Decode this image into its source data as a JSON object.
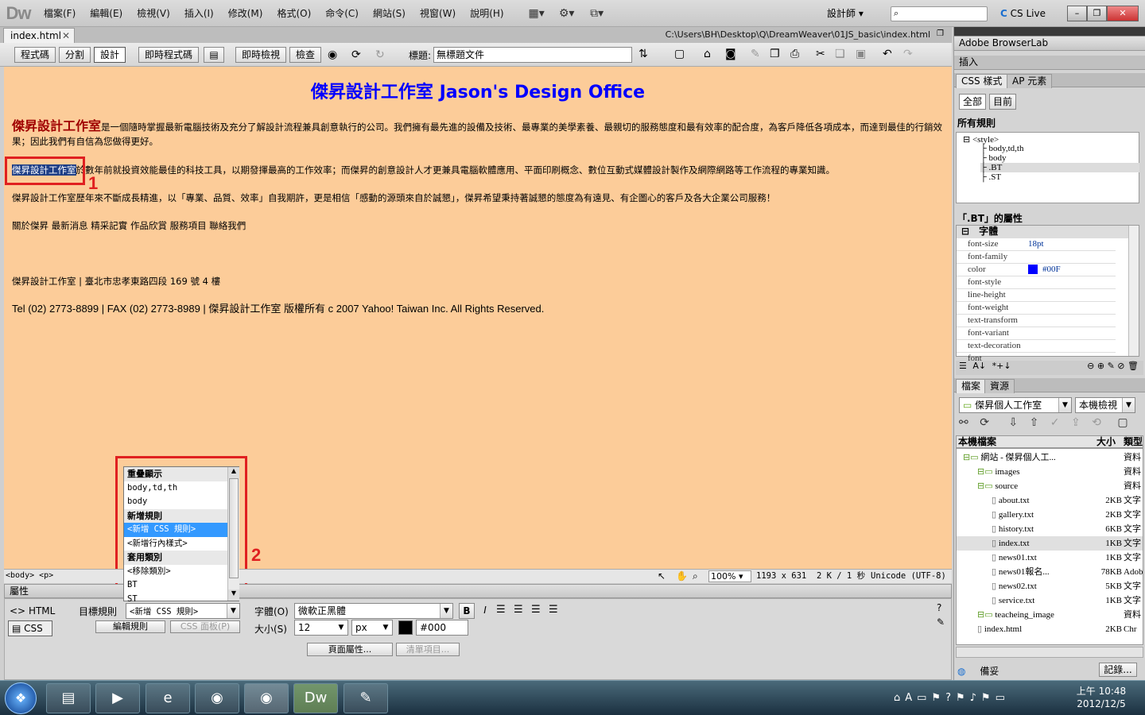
{
  "app": {
    "logo": "Dw"
  },
  "menus": [
    "檔案(F)",
    "編輯(E)",
    "檢視(V)",
    "插入(I)",
    "修改(M)",
    "格式(O)",
    "命令(C)",
    "網站(S)",
    "視窗(W)",
    "說明(H)"
  ],
  "workspace": "設計師",
  "cslive": "CS Live",
  "document": {
    "tab": "index.html",
    "path": "C:\\Users\\BH\\Desktop\\Q\\DreamWeaver\\01JS_basic\\index.html"
  },
  "toolbar": {
    "code": "程式碼",
    "split": "分割",
    "design": "設計",
    "livecode": "即時程式碼",
    "liveview": "即時檢視",
    "inspect": "檢查",
    "title_label": "標題:",
    "title_value": "無標題文件"
  },
  "page": {
    "heading": "傑昇設計工作室 Jason's Design Office",
    "p1_bt": "傑昇設計工作室",
    "p1_text": "是一個隨時掌握最新電腦技術及充分了解設計流程兼具創意執行的公司。我們擁有最先進的設備及技術、最專業的美學素養、最親切的服務態度和最有效率的配合度，為客戶降低各項成本，而達到最佳的行銷效果；因此我們有自信為您做得更好。",
    "p2_sel": "傑昇設計工作室",
    "p2_text": "於數年前就投資效能最佳的科技工具，以期發揮最高的工作效率；而傑昇的創意設計人才更兼具電腦軟體應用、平面印刷概念、數位互動式媒體設計製作及網際網路等工作流程的專業知識。",
    "p3": "傑昇設計工作室歷年來不斷成長精進，以「專業、品質、效率」自我期許，更是相信「感動的源頭來自於誠懇」，傑昇希望秉持著誠懇的態度為有遠見、有企圖心的客戶及各大企業公司服務！",
    "nav": "關於傑昇 最新消息 精采記實 作品欣賞 服務項目 聯絡我們",
    "address": "傑昇設計工作室 | 臺北市忠孝東路四段 169 號 4 樓",
    "footer": "Tel (02) 2773-8899 | FAX (02) 2773-8989 | 傑昇設計工作室 版權所有 c 2007 Yahoo! Taiwan Inc. All Rights Reserved."
  },
  "annotations": {
    "one": "1",
    "two": "2"
  },
  "status": {
    "tags": "<body> <p>",
    "zoom": "100%",
    "size": "1193 x 631",
    "download": "2 K / 1 秒",
    "encoding": "Unicode (UTF-8)"
  },
  "properties": {
    "title": "屬性",
    "html": "HTML",
    "css": "CSS",
    "target_rule_label": "目標規則",
    "target_rule_value": "<新增 CSS 規則>",
    "edit_rule": "編輯規則",
    "css_panel": "CSS 面板(P)",
    "font_label": "字體(O)",
    "font_value": "微軟正黑體",
    "size_label": "大小(S)",
    "size_value": "12",
    "unit_value": "px",
    "color_value": "#000",
    "page_props": "頁面屬性...",
    "list_items": "清單項目..."
  },
  "rule_dropdown": [
    {
      "text": "重疊顯示",
      "kind": "hdr"
    },
    {
      "text": "body,td,th",
      "kind": "item"
    },
    {
      "text": "body",
      "kind": "item"
    },
    {
      "text": "新增規則",
      "kind": "hdr"
    },
    {
      "text": "<新增 CSS 規則>",
      "kind": "hl"
    },
    {
      "text": "<新增行內樣式>",
      "kind": "item"
    },
    {
      "text": "套用類別",
      "kind": "hdr"
    },
    {
      "text": "<移除類別>",
      "kind": "item"
    },
    {
      "text": "BT",
      "kind": "item"
    },
    {
      "text": "ST",
      "kind": "item"
    }
  ],
  "right": {
    "browserlab": "Adobe BrowserLab",
    "insert": "插入",
    "css_tab": "CSS 樣式",
    "ap_tab": "AP 元素",
    "all": "全部",
    "current": "目前",
    "all_rules": "所有規則",
    "rules_tree": [
      "<style>",
      "body,td,th",
      "body",
      ".BT",
      ".ST"
    ],
    "props_title": "「.BT」的屬性",
    "font_group": "字體",
    "css_props": [
      {
        "k": "font-size",
        "v": "18pt"
      },
      {
        "k": "font-family",
        "v": ""
      },
      {
        "k": "color",
        "v": "#00F"
      },
      {
        "k": "font-style",
        "v": ""
      },
      {
        "k": "line-height",
        "v": ""
      },
      {
        "k": "font-weight",
        "v": ""
      },
      {
        "k": "text-transform",
        "v": ""
      },
      {
        "k": "font-variant",
        "v": ""
      },
      {
        "k": "text-decoration",
        "v": ""
      },
      {
        "k": "font",
        "v": ""
      }
    ],
    "files_tab": "檔案",
    "assets_tab": "資源",
    "site_select": "傑昇個人工作室",
    "view_select": "本機檢視",
    "col_local": "本機檔案",
    "col_size": "大小",
    "col_type": "類型",
    "files": [
      {
        "name": "網站 - 傑昇個人工...",
        "size": "",
        "type": "資料",
        "lvl": 0,
        "kind": "folder"
      },
      {
        "name": "images",
        "size": "",
        "type": "資料",
        "lvl": 1,
        "kind": "folder"
      },
      {
        "name": "source",
        "size": "",
        "type": "資料",
        "lvl": 1,
        "kind": "folder"
      },
      {
        "name": "about.txt",
        "size": "2KB",
        "type": "文字",
        "lvl": 2,
        "kind": "file"
      },
      {
        "name": "gallery.txt",
        "size": "2KB",
        "type": "文字",
        "lvl": 2,
        "kind": "file"
      },
      {
        "name": "history.txt",
        "size": "6KB",
        "type": "文字",
        "lvl": 2,
        "kind": "file"
      },
      {
        "name": "index.txt",
        "size": "1KB",
        "type": "文字",
        "lvl": 2,
        "kind": "file"
      },
      {
        "name": "news01.txt",
        "size": "1KB",
        "type": "文字",
        "lvl": 2,
        "kind": "file"
      },
      {
        "name": "news01報名...",
        "size": "78KB",
        "type": "Adob",
        "lvl": 2,
        "kind": "file"
      },
      {
        "name": "news02.txt",
        "size": "5KB",
        "type": "文字",
        "lvl": 2,
        "kind": "file"
      },
      {
        "name": "service.txt",
        "size": "1KB",
        "type": "文字",
        "lvl": 2,
        "kind": "file"
      },
      {
        "name": "teacheing_image",
        "size": "",
        "type": "資料",
        "lvl": 1,
        "kind": "folder"
      },
      {
        "name": "index.html",
        "size": "2KB",
        "type": "Chr",
        "lvl": 1,
        "kind": "file"
      }
    ],
    "ready": "備妥",
    "log": "記錄..."
  },
  "taskbar": {
    "time": "上午 10:48",
    "date": "2012/12/5"
  },
  "colors": {
    "design_bg": "#fccc99",
    "heading": "#0000ff",
    "bt": "#a00000",
    "annot": "#e02020",
    "swatch_blue": "#0000ff"
  }
}
